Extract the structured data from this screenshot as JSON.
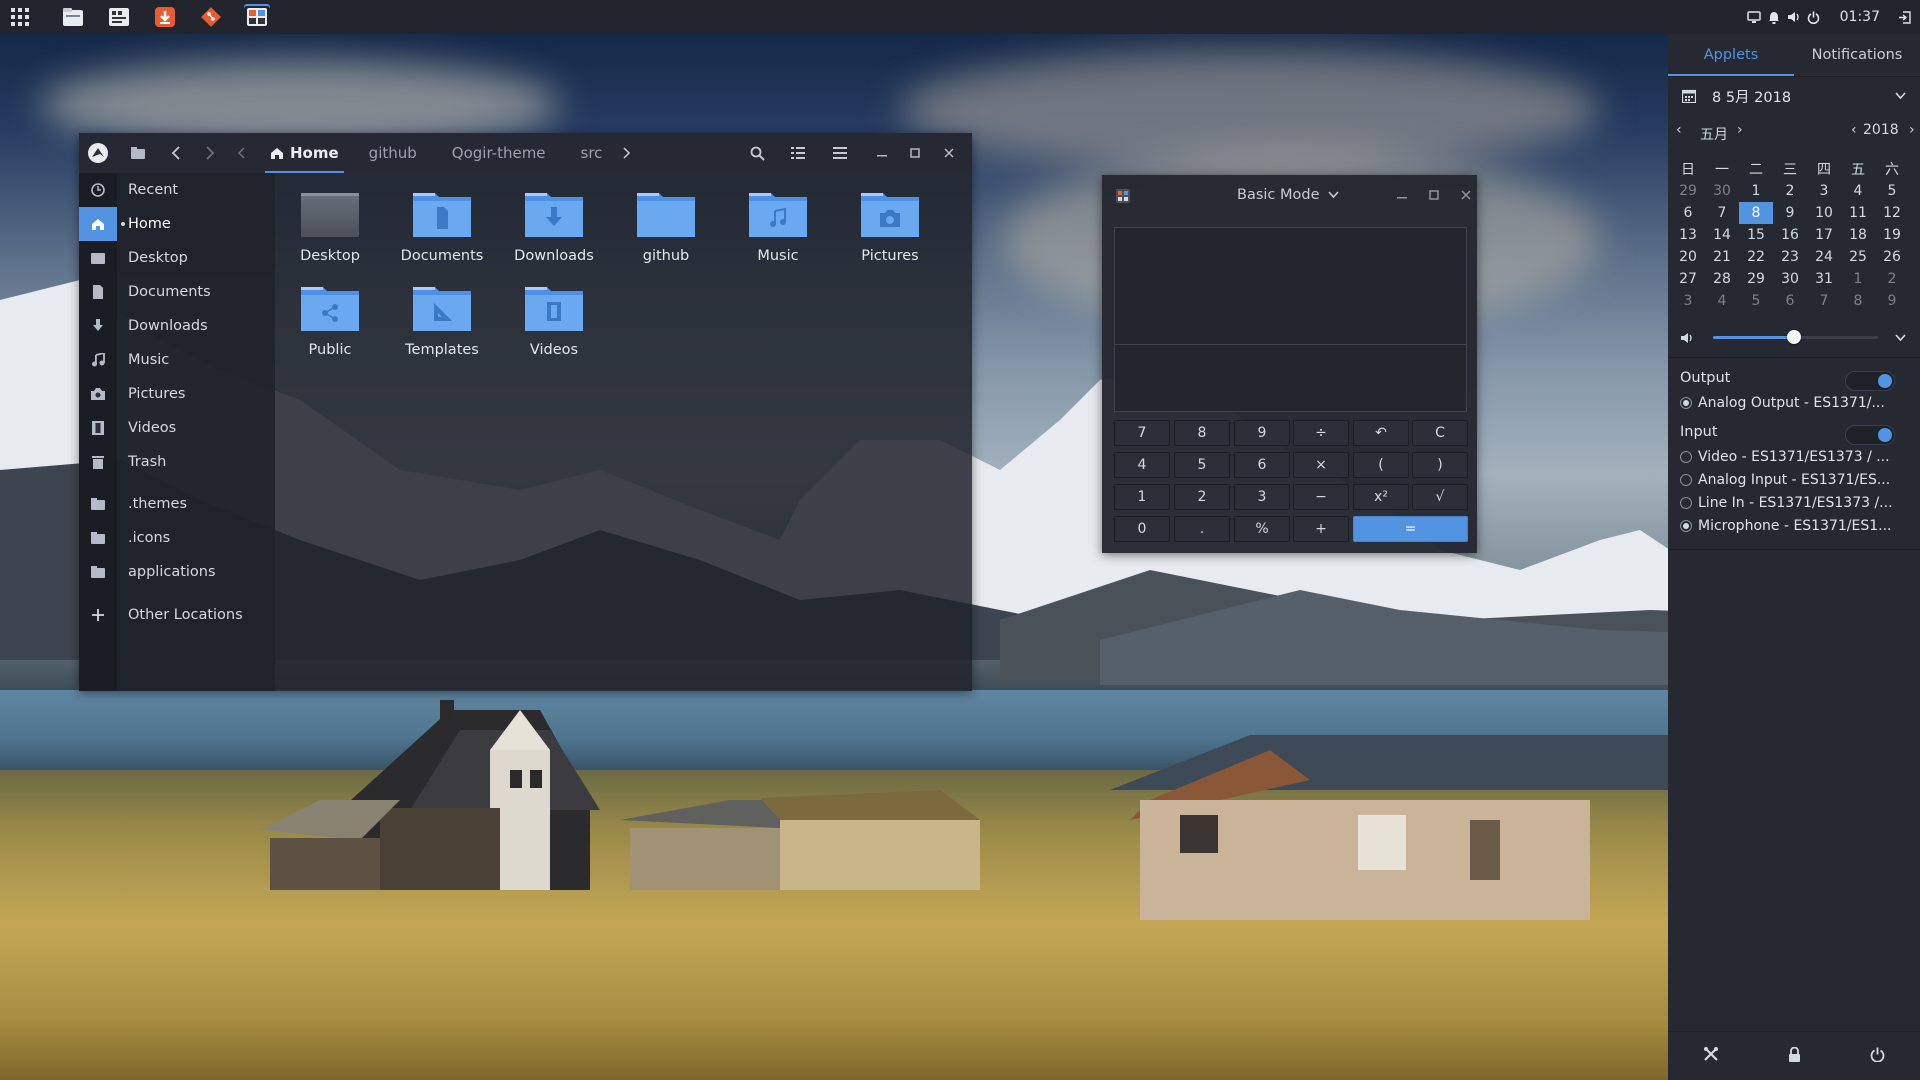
{
  "panel": {
    "clock": "01:37",
    "launchers": [
      "files-icon",
      "system-monitor-icon",
      "download-manager-icon",
      "git-icon",
      "calculator-icon"
    ]
  },
  "files": {
    "breadcrumbs": [
      "Home",
      "github",
      "Qogir-theme",
      "src"
    ],
    "sidebar": [
      {
        "label": "Recent",
        "icon": "clock-icon"
      },
      {
        "label": "Home",
        "icon": "home-icon",
        "active": true
      },
      {
        "label": "Desktop",
        "icon": "desktop-folder-icon"
      },
      {
        "label": "Documents",
        "icon": "document-icon"
      },
      {
        "label": "Downloads",
        "icon": "download-icon"
      },
      {
        "label": "Music",
        "icon": "music-icon"
      },
      {
        "label": "Pictures",
        "icon": "camera-icon"
      },
      {
        "label": "Videos",
        "icon": "film-icon"
      },
      {
        "label": "Trash",
        "icon": "trash-icon"
      },
      {
        "label": ".themes",
        "icon": "folder-icon"
      },
      {
        "label": ".icons",
        "icon": "folder-icon"
      },
      {
        "label": "applications",
        "icon": "folder-icon"
      },
      {
        "label": "Other Locations",
        "icon": "plus-icon"
      }
    ],
    "folders": [
      {
        "label": "Desktop",
        "icon": "desktop"
      },
      {
        "label": "Documents",
        "icon": "documents"
      },
      {
        "label": "Downloads",
        "icon": "downloads"
      },
      {
        "label": "github",
        "icon": "plain"
      },
      {
        "label": "Music",
        "icon": "music"
      },
      {
        "label": "Pictures",
        "icon": "pictures"
      },
      {
        "label": "Public",
        "icon": "public"
      },
      {
        "label": "Templates",
        "icon": "templates"
      },
      {
        "label": "Videos",
        "icon": "videos"
      }
    ]
  },
  "calculator": {
    "mode": "Basic Mode",
    "keys": [
      [
        "7",
        "8",
        "9",
        "÷",
        "↶",
        "C"
      ],
      [
        "4",
        "5",
        "6",
        "×",
        "(",
        ")"
      ],
      [
        "1",
        "2",
        "3",
        "−",
        "x²",
        "√"
      ],
      [
        "0",
        ".",
        "%",
        "+",
        "="
      ]
    ]
  },
  "sidebar": {
    "tabs": [
      "Applets",
      "Notifications"
    ],
    "date": "8 5月 2018",
    "month": "五月",
    "year": "2018",
    "weekdays": [
      "日",
      "一",
      "二",
      "三",
      "四",
      "五",
      "六"
    ],
    "days": [
      [
        "29",
        "30",
        "1",
        "2",
        "3",
        "4",
        "5"
      ],
      [
        "6",
        "7",
        "8",
        "9",
        "10",
        "11",
        "12"
      ],
      [
        "13",
        "14",
        "15",
        "16",
        "17",
        "18",
        "19"
      ],
      [
        "20",
        "21",
        "22",
        "23",
        "24",
        "25",
        "26"
      ],
      [
        "27",
        "28",
        "29",
        "30",
        "31",
        "1",
        "2"
      ],
      [
        "3",
        "4",
        "5",
        "6",
        "7",
        "8",
        "9"
      ]
    ],
    "volume_level": 0.49,
    "output_label": "Output",
    "output_device": "Analog Output - ES1371/...",
    "input_label": "Input",
    "input_devices": [
      {
        "label": "Video - ES1371/ES1373 / ...",
        "selected": false
      },
      {
        "label": "Analog Input - ES1371/ES...",
        "selected": false
      },
      {
        "label": "Line In - ES1371/ES1373 /...",
        "selected": false
      },
      {
        "label": "Microphone - ES1371/ES1...",
        "selected": true
      }
    ]
  },
  "colors": {
    "accent": "#5294e2",
    "panel": "#23252e",
    "window": "#21242c",
    "sidebar": "#262931"
  }
}
